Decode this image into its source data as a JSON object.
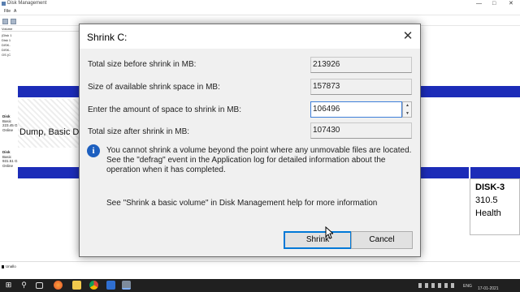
{
  "window": {
    "title": "Disk Management",
    "controls": [
      "—",
      "□",
      "✕"
    ]
  },
  "menu": {
    "items": [
      "File",
      "A"
    ]
  },
  "volume_list": {
    "header": "Volume",
    "rows": [
      "(Disk 1",
      "Disk 1",
      "DISK-",
      "DISK-",
      "OS (C"
    ]
  },
  "disks": {
    "disk0": {
      "name": "Disk",
      "type": "Basic",
      "size": "223.45 G",
      "status": "Online"
    },
    "disk1": {
      "name": "Disk",
      "type": "Basic",
      "size": "931.51 G",
      "status": "Online"
    },
    "partition_dump": "Dump, Basic D",
    "right_partition": {
      "name": "DISK-3",
      "size": "310.5",
      "status": "Health"
    },
    "unalloc_legend": "Unallo"
  },
  "dialog": {
    "title": "Shrink C:",
    "close_icon": "close-icon",
    "fields": {
      "total_before_label": "Total size before shrink in MB:",
      "total_before_value": "213926",
      "available_label": "Size of available shrink space in MB:",
      "available_value": "157873",
      "amount_label": "Enter the amount of space to shrink in MB:",
      "amount_value": "106496",
      "total_after_label": "Total size after shrink in MB:",
      "total_after_value": "107430"
    },
    "info_text": "You cannot shrink a volume beyond the point where any unmovable files are located. See the \"defrag\" event in the Application log for detailed information about the operation when it has completed.",
    "help_text": "See \"Shrink a basic volume\" in Disk Management help for more information",
    "buttons": {
      "shrink": "Shrink",
      "cancel": "Cancel"
    }
  },
  "taskbar": {
    "tray_lang": "ENG",
    "tray_time": "",
    "tray_date": "17-01-2021"
  },
  "colors": {
    "partition_bar": "#1c2cb8",
    "dialog_bg": "#f0f0f0",
    "focus_border": "#0078d7"
  }
}
